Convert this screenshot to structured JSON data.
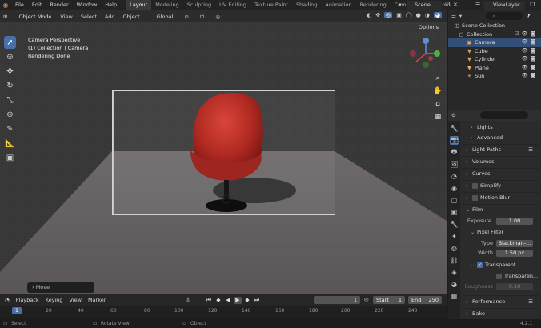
{
  "topbar": {
    "menu": [
      "File",
      "Edit",
      "Render",
      "Window",
      "Help"
    ],
    "workspaces": [
      "Layout",
      "Modeling",
      "Sculpting",
      "UV Editing",
      "Texture Paint",
      "Shading",
      "Animation",
      "Rendering",
      "Compositing",
      "Geom"
    ],
    "active_workspace": "Layout",
    "scene": "Scene",
    "view_layer": "ViewLayer"
  },
  "viewport": {
    "mode": "Object Mode",
    "header_items": [
      "View",
      "Select",
      "Add",
      "Object"
    ],
    "orientation": "Global",
    "options": "Options",
    "info_lines": [
      "Camera Perspective",
      "(1) Collection | Camera",
      "Rendering Done"
    ],
    "last_operator": "Move",
    "gizmo_labels": {
      "x": "X",
      "y": "Y",
      "z": "Z"
    }
  },
  "outliner": {
    "search_placeholder": "",
    "rows": [
      {
        "label": "Scene Collection",
        "icon": "scene-collection-icon"
      },
      {
        "label": "Collection",
        "icon": "collection-icon"
      },
      {
        "label": "Camera",
        "icon": "camera-icon"
      },
      {
        "label": "Cube",
        "icon": "cube-icon"
      },
      {
        "label": "Cylinder",
        "icon": "cylinder-icon"
      },
      {
        "label": "Plane",
        "icon": "plane-icon"
      },
      {
        "label": "Sun",
        "icon": "sun-icon"
      }
    ]
  },
  "properties": {
    "rows": [
      {
        "label": "Lights"
      },
      {
        "label": "Advanced"
      },
      {
        "label": "Light Paths"
      },
      {
        "label": "Volumes"
      },
      {
        "label": "Curves"
      },
      {
        "label": "Simplify"
      },
      {
        "label": "Motion Blur"
      },
      {
        "label": "Film"
      },
      {
        "label": "Exposure",
        "value": "1.00"
      },
      {
        "label": "Pixel Filter"
      },
      {
        "label": "Type",
        "value": "Blackman-..."
      },
      {
        "label": "Width",
        "value": "1.50 px"
      },
      {
        "label": "Transparent"
      },
      {
        "label": "Transparen..."
      },
      {
        "label": "Roughness",
        "value": "0.10"
      },
      {
        "label": "Performance"
      },
      {
        "label": "Bake"
      }
    ]
  },
  "timeline": {
    "menu": [
      "Playback",
      "Keying",
      "View",
      "Marker"
    ],
    "current_frame": "1",
    "start_label": "Start",
    "start": "1",
    "end_label": "End",
    "end": "250",
    "ticks": [
      "1",
      "20",
      "40",
      "60",
      "80",
      "100",
      "120",
      "140",
      "160",
      "180",
      "200",
      "220",
      "240"
    ]
  },
  "statusbar": {
    "select": "Select",
    "rotate": "Rotate View",
    "object": "Object",
    "version": "4.2.1"
  },
  "colors": {
    "accent": "#4a6fa8",
    "chair": "#b42a22",
    "logo": "#e8882f"
  }
}
